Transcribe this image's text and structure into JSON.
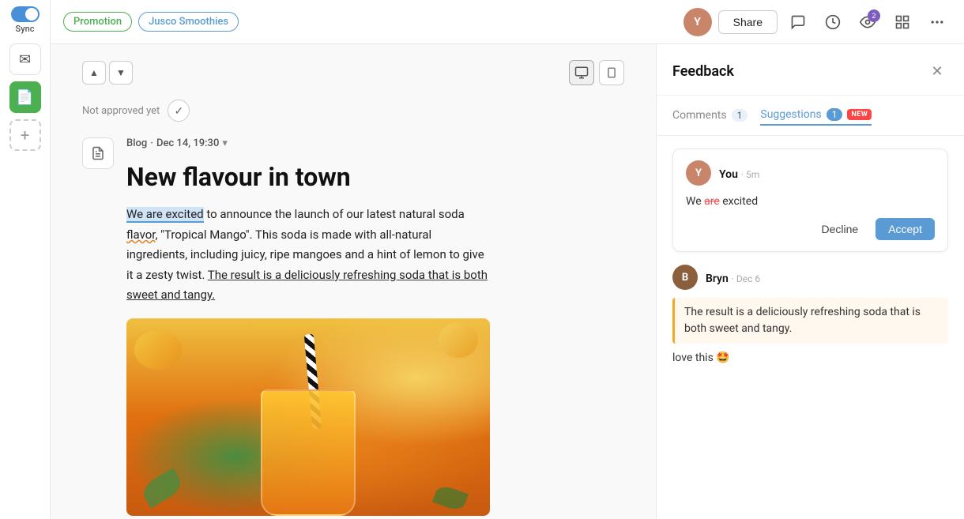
{
  "sidebar": {
    "toggle_on": true,
    "sync_label": "Sync",
    "icons": [
      {
        "name": "mail-icon",
        "label": "✉"
      },
      {
        "name": "doc-icon",
        "label": "📄"
      },
      {
        "name": "add-icon",
        "label": "+"
      }
    ]
  },
  "topbar": {
    "tag_promotion": "Promotion",
    "tag_jusco": "Jusco Smoothies",
    "share_label": "Share",
    "icons": {
      "chat": "💬",
      "history": "🕐",
      "eye_badge": "👁",
      "grid": "▦",
      "more": "•••"
    }
  },
  "editor": {
    "nav_up": "▲",
    "nav_down": "▼",
    "view_desktop": "🖥",
    "view_mobile": "📱",
    "not_approved": "Not approved yet",
    "blog_label": "Blog",
    "date": "Dec 14, 19:30",
    "title": "New flavour in town",
    "body_part1": "We are excited",
    "body_part2": " to announce the launch of our latest natural soda flavor, \"Tropical Mango\". This soda is made with all-natural ingredients, including juicy, ripe mangoes and a hint of lemon to give it a zesty twist. ",
    "body_part3": "The result is a deliciously refreshing soda that is both sweet and tangy.",
    "image_alt": "Mango smoothie drink with straw"
  },
  "feedback": {
    "title": "Feedback",
    "tabs": {
      "comments_label": "Comments",
      "comments_count": "1",
      "suggestions_label": "Suggestions",
      "suggestions_count": "1",
      "new_badge": "NEW"
    },
    "suggestions": [
      {
        "author": "You",
        "time": "5m",
        "text_del": "are",
        "text_full": "We are excited",
        "decline_label": "Decline",
        "accept_label": "Accept"
      }
    ],
    "comments": [
      {
        "author": "Bryn",
        "date": "Dec 6",
        "quote": "The result is a deliciously refreshing soda that is both sweet and tangy.",
        "text": "love this 🤩"
      }
    ]
  }
}
